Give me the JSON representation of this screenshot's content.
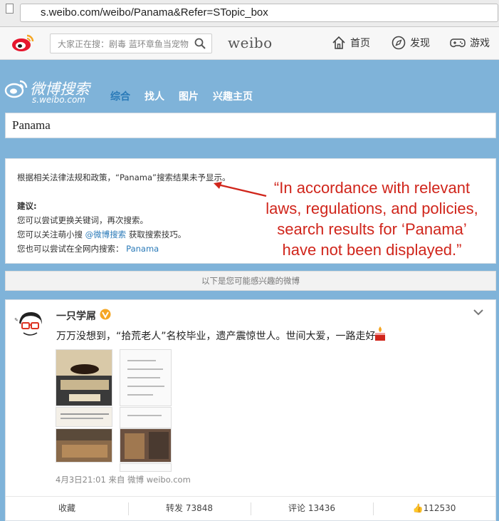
{
  "browser": {
    "url": "s.weibo.com/weibo/Panama&Refer=STopic_box"
  },
  "topnav": {
    "search_placeholder": "大家正在搜：剧毒 蓝环章鱼当宠物",
    "brand": "weibo",
    "items": [
      {
        "label": "首页",
        "icon": "home-icon"
      },
      {
        "label": "发现",
        "icon": "compass-icon"
      },
      {
        "label": "游戏",
        "icon": "gamepad-icon"
      }
    ]
  },
  "search_header": {
    "title": "微博搜索",
    "subtitle": "s.weibo.com",
    "tabs": [
      "综合",
      "找人",
      "图片",
      "兴趣主页"
    ]
  },
  "query": "Panama",
  "notice": {
    "line1": "根据相关法律法规和政策，“Panama”搜索结果未予显示。",
    "suggest_heading": "建议:",
    "s1": "您可以尝试更换关键词，再次搜索。",
    "s2_prefix": "您可以关注萌小搜",
    "s2_link": "@微博搜索",
    "s2_suffix": "获取搜索技巧。",
    "s3_prefix": "您也可以尝试在全网内搜索：",
    "s3_link": "Panama"
  },
  "annotation": {
    "line1": "“In accordance with relevant",
    "line2": "laws, regulations, and policies,",
    "line3": "search results for ‘Panama’",
    "line4": "have not been displayed.”"
  },
  "interest_bar": "以下是您可能感兴趣的微博",
  "post": {
    "username": "一只学屌",
    "text": "万万没想到，“拾荒老人”名校毕业，遗产震惊世人。世间大爱，一路走好.",
    "meta": "4月3日21:01 来自 微博 weibo.com",
    "actions": {
      "favorite": "收藏",
      "repost": "转发 73848",
      "comment": "评论 13436",
      "like": "112530"
    }
  },
  "colors": {
    "accent_blue": "#2a7ab8",
    "annotation_red": "#d0251b",
    "weibo_red": "#e6162d",
    "page_bg": "#7fb3d9"
  }
}
